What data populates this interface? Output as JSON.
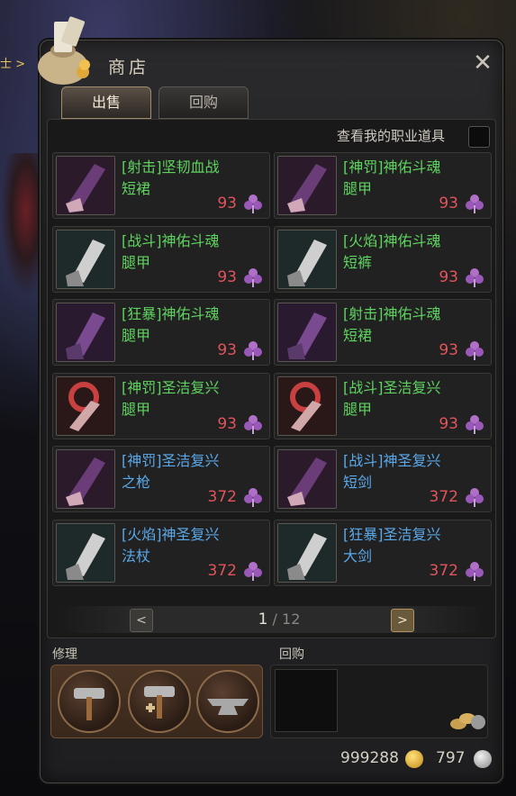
{
  "background": {
    "side_text": "士 >"
  },
  "shop": {
    "title": "商店",
    "close_label": "✕",
    "tabs": [
      {
        "label": "出售",
        "active": true
      },
      {
        "label": "回购",
        "active": false
      }
    ],
    "filter_label": "查看我的职业道具"
  },
  "items": [
    {
      "line1": "[射击]坚韧血战",
      "line2": "短裙",
      "price": "93",
      "color": "green",
      "icon": "glove-purple-icon"
    },
    {
      "line1": "[神罚]神佑斗魂",
      "line2": "腿甲",
      "price": "93",
      "color": "green",
      "icon": "glove-purple-icon"
    },
    {
      "line1": "[战斗]神佑斗魂",
      "line2": "腿甲",
      "price": "93",
      "color": "green",
      "icon": "gauntlet-silver-icon"
    },
    {
      "line1": "[火焰]神佑斗魂",
      "line2": "短裤",
      "price": "93",
      "color": "green",
      "icon": "gauntlet-silver-icon"
    },
    {
      "line1": "[狂暴]神佑斗魂",
      "line2": "腿甲",
      "price": "93",
      "color": "green",
      "icon": "gauntlet-violet-icon"
    },
    {
      "line1": "[射击]神佑斗魂",
      "line2": "短裙",
      "price": "93",
      "color": "green",
      "icon": "gauntlet-violet-icon"
    },
    {
      "line1": "[神罚]圣洁复兴",
      "line2": "腿甲",
      "price": "93",
      "color": "green",
      "icon": "hook-red-icon"
    },
    {
      "line1": "[战斗]圣洁复兴",
      "line2": "腿甲",
      "price": "93",
      "color": "green",
      "icon": "hook-red-icon"
    },
    {
      "line1": "[神罚]圣洁复兴",
      "line2": "之枪",
      "price": "372",
      "color": "blue",
      "icon": "glove-purple-icon"
    },
    {
      "line1": "[战斗]神圣复兴",
      "line2": "短剑",
      "price": "372",
      "color": "blue",
      "icon": "glove-purple-icon"
    },
    {
      "line1": "[火焰]神圣复兴",
      "line2": "法杖",
      "price": "372",
      "color": "blue",
      "icon": "gauntlet-silver-icon"
    },
    {
      "line1": "[狂暴]圣洁复兴",
      "line2": "大剑",
      "price": "372",
      "color": "blue",
      "icon": "gauntlet-silver-icon"
    }
  ],
  "pagination": {
    "current": "1",
    "total": "/ 12",
    "prev_label": "<",
    "next_label": ">"
  },
  "repair": {
    "label": "修理"
  },
  "buyback": {
    "label": "回购"
  },
  "currency": {
    "gold": "999288",
    "silver": "797"
  },
  "colors": {
    "green_name": "#5fd35f",
    "blue_name": "#5aa8e8",
    "price": "#e2545a"
  }
}
